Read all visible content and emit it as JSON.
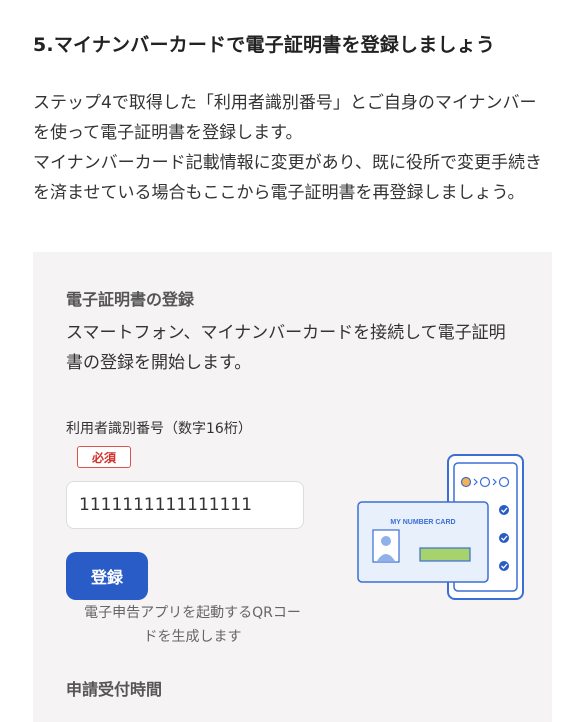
{
  "section": {
    "title": "5.マイナンバーカードで電子証明書を登録しましょう",
    "paragraph1": "ステップ4で取得した「利用者識別番号」とご自身のマイナンバーを使って電子証明書を登録します。",
    "paragraph2": "マイナンバーカード記載情報に変更があり、既に役所で変更手続きを済ませている場合もここから電子証明書を再登録しましょう。"
  },
  "panel": {
    "heading": "電子証明書の登録",
    "description": "スマートフォン、マイナンバーカードを接続して電子証明書の登録を開始します。",
    "field_label": "利用者識別番号（数字16桁）",
    "required_label": "必須",
    "id_value": "1111111111111111",
    "register_button": "登録",
    "qr_note": "電子申告アプリを起動するQRコードを生成します",
    "card_label": "MY NUMBER CARD",
    "next_heading": "申請受付時間"
  },
  "colors": {
    "accent": "#2a5cc7",
    "required": "#d0312d",
    "panel_bg": "#f5f3f3"
  }
}
